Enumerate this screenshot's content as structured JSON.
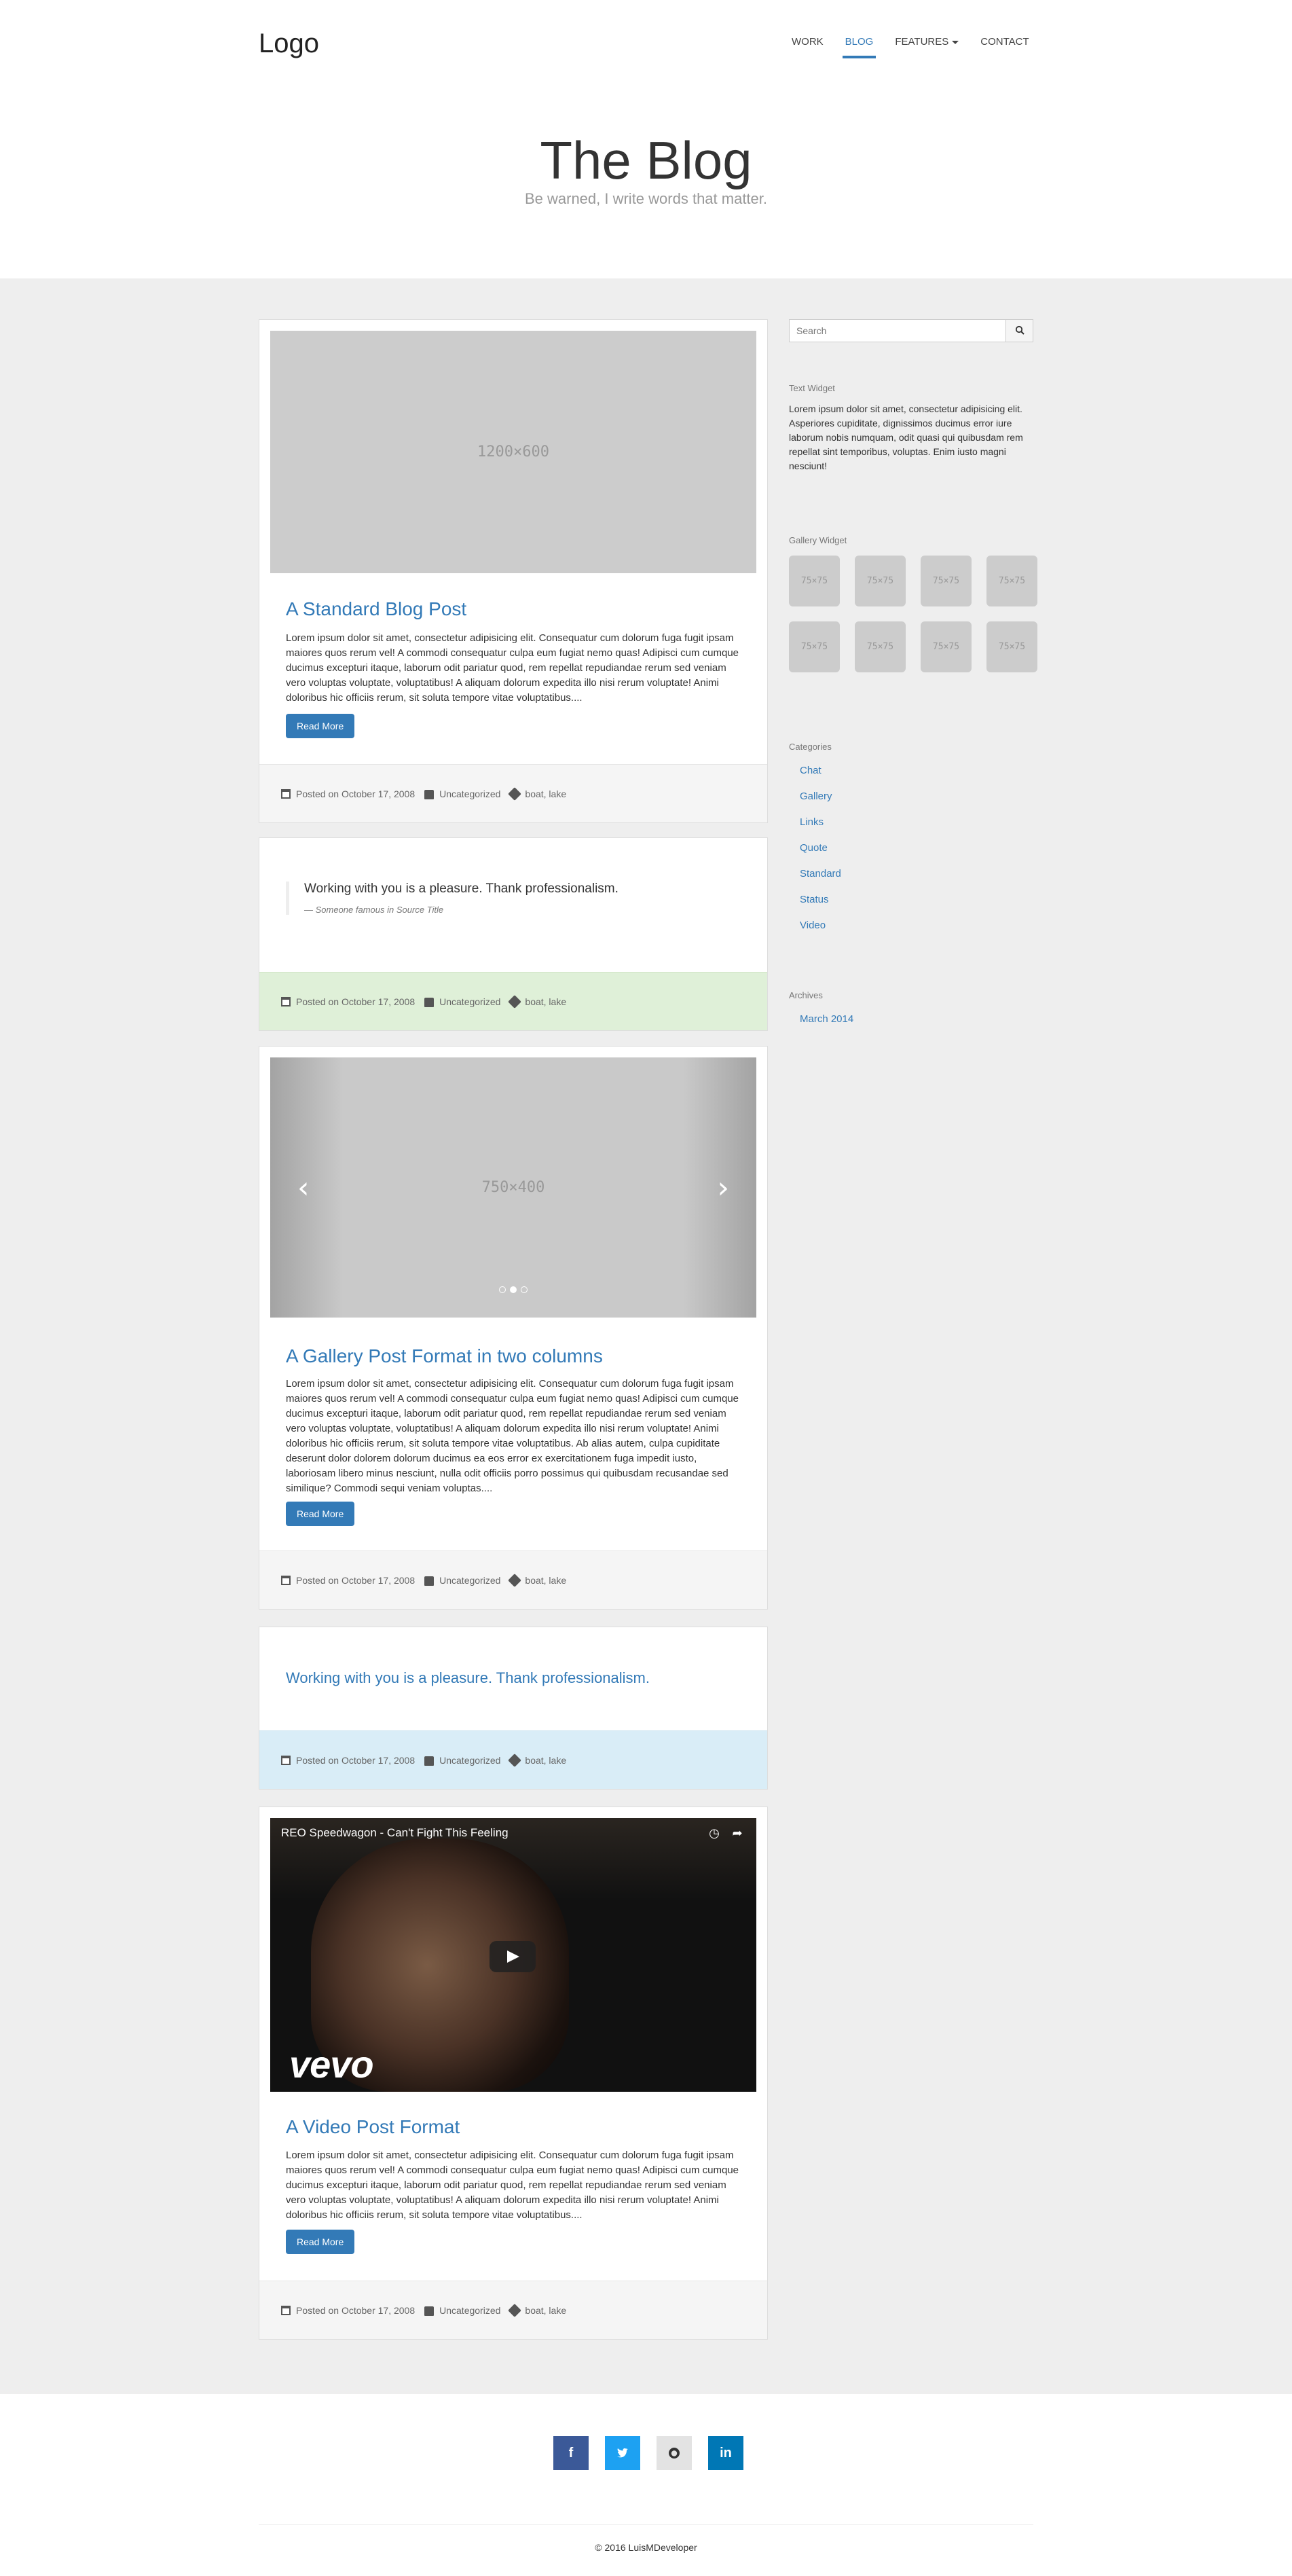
{
  "nav": {
    "logo": "Logo",
    "items": [
      {
        "label": "WORK"
      },
      {
        "label": "BLOG"
      },
      {
        "label": "FEATURES"
      },
      {
        "label": "CONTACT"
      }
    ]
  },
  "hero": {
    "title": "The Blog",
    "subtitle": "Be warned, I write words that matter."
  },
  "posts": [
    {
      "title": "A Standard Blog Post",
      "image": "1200×600",
      "excerpt": "Lorem ipsum dolor sit amet, consectetur adipisicing elit. Consequatur cum dolorum fuga fugit ipsam maiores quos rerum vel! A commodi consequatur culpa eum fugiat nemo quas! Adipisci cum cumque ducimus excepturi itaque, laborum odit pariatur quod, rem repellat repudiandae rerum sed veniam vero voluptas voluptate, voluptatibus! A aliquam dolorum expedita illo nisi rerum voluptate! Animi doloribus hic officiis rerum, sit soluta tempore vitae voluptatibus....",
      "button": "Read More",
      "date": "Posted on October 17, 2008",
      "category": "Uncategorized",
      "tags": "boat, lake"
    },
    {
      "quote": "Working with you is a pleasure. Thank professionalism.",
      "source_prefix": "— Someone famous in",
      "source_title": "Source Title",
      "date": "Posted on October 17, 2008",
      "category": "Uncategorized",
      "tags": "boat, lake"
    },
    {
      "title": "A Gallery Post Format in two columns",
      "image": "750×400",
      "excerpt": "Lorem ipsum dolor sit amet, consectetur adipisicing elit. Consequatur cum dolorum fuga fugit ipsam maiores quos rerum vel! A commodi consequatur culpa eum fugiat nemo quas! Adipisci cum cumque ducimus excepturi itaque, laborum odit pariatur quod, rem repellat repudiandae rerum sed veniam vero voluptas voluptate, voluptatibus! A aliquam dolorum expedita illo nisi rerum voluptate! Animi doloribus hic officiis rerum, sit soluta tempore vitae voluptatibus. Ab alias autem, culpa cupiditate deserunt dolor dolorem dolorum ducimus ea eos error ex exercitationem fuga impedit iusto, laboriosam libero minus nesciunt, nulla odit officiis porro possimus qui quibusdam recusandae sed similique? Commodi sequi veniam voluptas....",
      "button": "Read More",
      "date": "Posted on October 17, 2008",
      "category": "Uncategorized",
      "tags": "boat, lake"
    },
    {
      "quote": "Working with you is a pleasure. Thank professionalism.",
      "date": "Posted on October 17, 2008",
      "category": "Uncategorized",
      "tags": "boat, lake"
    },
    {
      "title": "A Video Post Format",
      "video_title": "REO Speedwagon - Can't Fight This Feeling",
      "video_brand": "vevo",
      "excerpt": "Lorem ipsum dolor sit amet, consectetur adipisicing elit. Consequatur cum dolorum fuga fugit ipsam maiores quos rerum vel! A commodi consequatur culpa eum fugiat nemo quas! Adipisci cum cumque ducimus excepturi itaque, laborum odit pariatur quod, rem repellat repudiandae rerum sed veniam vero voluptas voluptate, voluptatibus! A aliquam dolorum expedita illo nisi rerum voluptate! Animi doloribus hic officiis rerum, sit soluta tempore vitae voluptatibus....",
      "button": "Read More",
      "date": "Posted on October 17, 2008",
      "category": "Uncategorized",
      "tags": "boat, lake"
    }
  ],
  "sidebar": {
    "search_placeholder": "Search",
    "text_widget_title": "Text Widget",
    "text_widget_body": "Lorem ipsum dolor sit amet, consectetur adipisicing elit. Asperiores cupiditate, dignissimos ducimus error iure laborum nobis numquam, odit quasi qui quibusdam rem repellat sint temporibus, voluptas. Enim iusto magni nesciunt!",
    "gallery_widget_title": "Gallery Widget",
    "gallery_thumb": "75×75",
    "categories_title": "Categories",
    "categories": [
      "Chat",
      "Gallery",
      "Links",
      "Quote",
      "Standard",
      "Status",
      "Video"
    ],
    "archives_title": "Archives",
    "archives": [
      "March 2014"
    ]
  },
  "footer": {
    "social": [
      "f",
      "t",
      "gh",
      "in"
    ],
    "social_colors": [
      "#3b5998",
      "#1da1f2",
      "#e3e3e3",
      "#0077b5"
    ],
    "copyright": "2016 LuisMDeveloper"
  },
  "colors": {
    "accent": "#337ab7",
    "background": "#eeeeee"
  }
}
